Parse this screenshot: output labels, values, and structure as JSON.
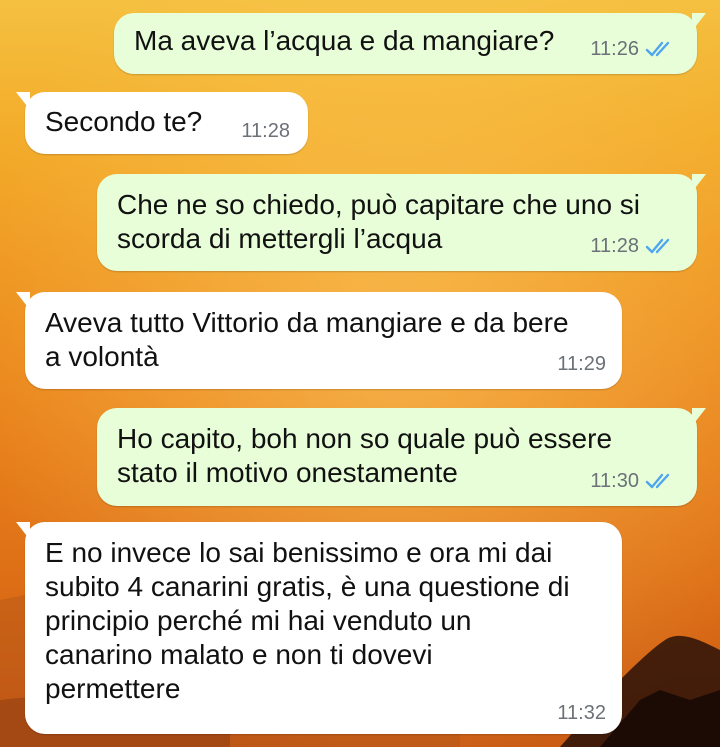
{
  "chat": {
    "messages": [
      {
        "direction": "out",
        "text": "Ma aveva l’acqua e da mangiare?",
        "time": "11:26",
        "status_icon": "double-check-read-icon"
      },
      {
        "direction": "in",
        "text": "Secondo te?",
        "time": "11:28"
      },
      {
        "direction": "out",
        "text": "Che ne so chiedo, può capitare che uno si\nscorda di mettergli l’acqua",
        "time": "11:28",
        "status_icon": "double-check-read-icon"
      },
      {
        "direction": "in",
        "text": "Aveva tutto Vittorio da mangiare e da bere\na volontà",
        "time": "11:29"
      },
      {
        "direction": "out",
        "text": "Ho capito, boh non so quale può essere\nstato il motivo onestamente",
        "time": "11:30",
        "status_icon": "double-check-read-icon"
      },
      {
        "direction": "in",
        "text": "E no invece lo sai benissimo e ora mi dai\nsubito 4 canarini gratis, è una questione di\nprincipio perché mi hai venduto un\ncanarino malato e non ti dovevi\npermettere",
        "time": "11:32"
      }
    ]
  },
  "colors": {
    "outgoing_bubble": "#e7fed8",
    "incoming_bubble": "#ffffff",
    "read_ticks": "#4fa6ee",
    "timestamp": "#6b7177",
    "wallpaper_top": "#f5c040",
    "wallpaper_bottom": "#c95a14"
  }
}
